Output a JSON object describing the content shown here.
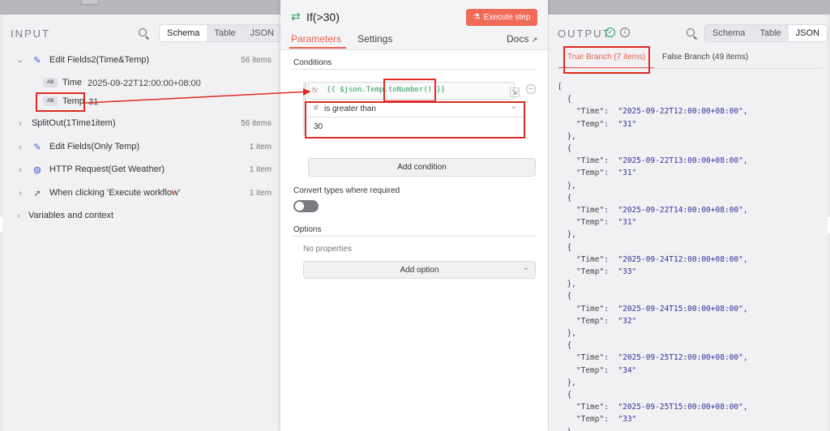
{
  "input": {
    "title": "INPUT",
    "view_modes": [
      "Schema",
      "Table",
      "JSON"
    ],
    "nodes": [
      {
        "label": "Edit Fields2(Time&Temp)",
        "count": "56 items",
        "icon": "pencil-icon",
        "color": "#3a5ad9"
      },
      {
        "label": "SplitOut(1Time1item)",
        "count": "56 items",
        "icon": "split-icon",
        "color": "#9b59b6"
      },
      {
        "label": "Edit Fields(Only Temp)",
        "count": "1 item",
        "icon": "pencil-icon",
        "color": "#3a5ad9"
      },
      {
        "label": "HTTP Request(Get Weather)",
        "count": "1 item",
        "icon": "globe-icon",
        "color": "#3a5ad9"
      },
      {
        "label": "When clicking ‘Execute workflow’",
        "count": "1 item",
        "icon": "cursor-icon",
        "color": "#555555"
      }
    ],
    "fields": [
      {
        "tag": "AB",
        "name": "Time",
        "value": "2025-09-22T12:00:00+08:00"
      },
      {
        "tag": "AB",
        "name": "Temp",
        "value": "31"
      }
    ],
    "variables_label": "Variables and context"
  },
  "modal": {
    "title": "If(>30)",
    "execute_label": "Execute step",
    "tabs": [
      "Parameters",
      "Settings"
    ],
    "docs_label": "Docs",
    "conditions_label": "Conditions",
    "expression_part1": "{{ $json.Temp.",
    "expression_part2": "toNumber()",
    "expression_part3": " }}",
    "fx_label": "fx",
    "operator_icon": "#",
    "operator": "is greater than",
    "value": "30",
    "add_condition_label": "Add condition",
    "convert_label": "Convert types where required",
    "options_label": "Options",
    "no_properties": "No properties",
    "add_option_label": "Add option"
  },
  "output": {
    "title": "OUTPUT",
    "view_modes": [
      "Schema",
      "Table",
      "JSON"
    ],
    "true_branch": "True Branch (7 items)",
    "false_branch": "False Branch (49 items)",
    "items": [
      {
        "Time": "2025-09-22T12:00:00+08:00",
        "Temp": "31"
      },
      {
        "Time": "2025-09-22T13:00:00+08:00",
        "Temp": "31"
      },
      {
        "Time": "2025-09-22T14:00:00+08:00",
        "Temp": "31"
      },
      {
        "Time": "2025-09-24T12:00:00+08:00",
        "Temp": "33"
      },
      {
        "Time": "2025-09-24T15:00:00+08:00",
        "Temp": "32"
      },
      {
        "Time": "2025-09-25T12:00:00+08:00",
        "Temp": "34"
      },
      {
        "Time": "2025-09-25T15:00:00+08:00",
        "Temp": "33"
      }
    ]
  },
  "colors": {
    "accent": "#e8604f",
    "annotation_red": "#e02a22",
    "success_green": "#2aa05a"
  }
}
